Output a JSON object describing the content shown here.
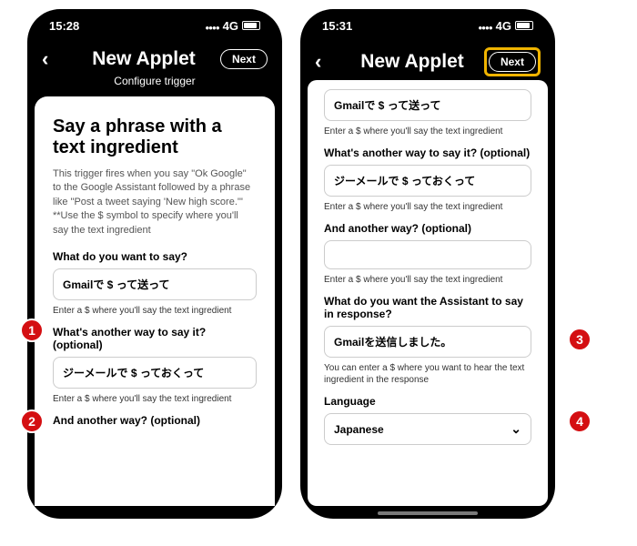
{
  "left": {
    "time": "15:28",
    "network": "4G",
    "header": {
      "title": "New Applet",
      "next": "Next"
    },
    "subheader": "Configure trigger",
    "h2": "Say a phrase with a text ingredient",
    "desc": "This trigger fires when you say \"Ok Google\" to the Google Assistant followed by a phrase like \"Post a tweet saying 'New high score.'\" **Use the $ symbol to specify where you'll say the text ingredient",
    "q1": "What do you want to say?",
    "v1": "Gmailで $ って送って",
    "hint1": "Enter a $ where you'll say the text ingredient",
    "q2": "What's another way to say it? (optional)",
    "v2": "ジーメールで $ っておくって",
    "hint2": "Enter a $ where you'll say the text ingredient",
    "q3": "And another way? (optional)"
  },
  "right": {
    "time": "15:31",
    "network": "4G",
    "header": {
      "title": "New Applet",
      "next": "Next"
    },
    "v_top": "Gmailで $ って送って",
    "hint_a": "Enter a $ where you'll say the text ingredient",
    "q2": "What's another way to say it? (optional)",
    "v2": "ジーメールで $ っておくって",
    "hint2": "Enter a $ where you'll say the text ingredient",
    "q3": "And another way? (optional)",
    "v3": "",
    "hint3": "Enter a $ where you'll say the text ingredient",
    "q4": "What do you want the Assistant to say in response?",
    "v4": "Gmailを送信しました。",
    "hint4": "You can enter a $ where you want to hear the text ingredient in the response",
    "q5": "Language",
    "lang": "Japanese"
  },
  "badges": {
    "b1": "1",
    "b2": "2",
    "b3": "3",
    "b4": "4"
  }
}
